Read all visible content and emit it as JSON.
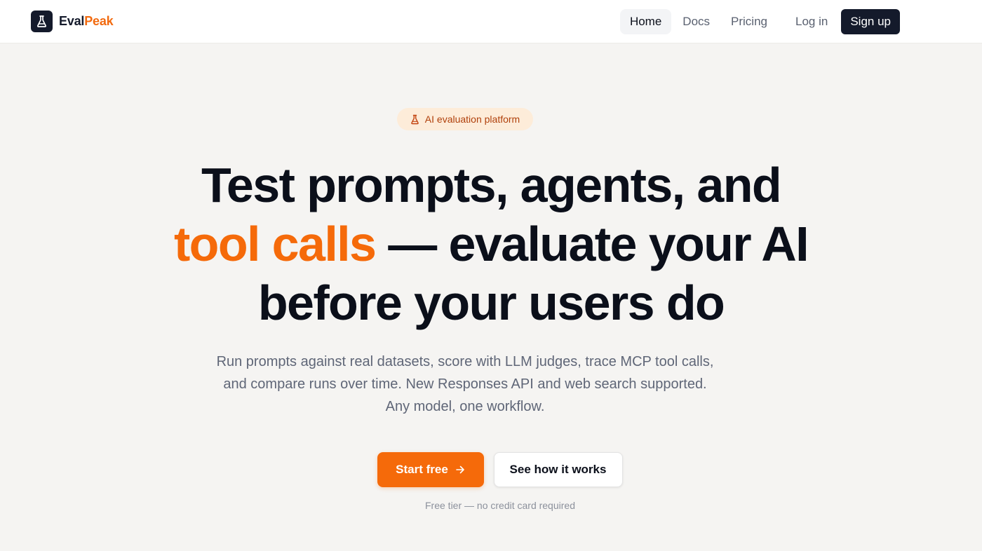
{
  "header": {
    "brand_part1": "Eval",
    "brand_part2": "Peak",
    "logo_icon": "flask-icon",
    "nav": [
      {
        "label": "Home",
        "active": true
      },
      {
        "label": "Docs"
      },
      {
        "label": "Pricing"
      }
    ],
    "login_label": "Log in",
    "signup_label": "Sign up"
  },
  "hero": {
    "badge_icon": "flask-icon",
    "badge_label": "AI evaluation platform",
    "headline_line1": "Test prompts, agents, and",
    "headline_accent": "tool calls",
    "headline_line2_rest": " — evaluate your AI",
    "headline_line3": "before your users do",
    "subtitle": "Run prompts against real datasets, score with LLM judges, trace MCP tool calls, and compare runs over time. New Responses API and web search supported. Any model, one workflow.",
    "primary_cta": "Start free",
    "primary_cta_icon": "arrow-right-icon",
    "secondary_cta": "See how it works",
    "note": "Free tier — no credit card required"
  },
  "colors": {
    "accent": "#f56a0a",
    "navy": "#141a2b",
    "background": "#f5f4f2"
  }
}
